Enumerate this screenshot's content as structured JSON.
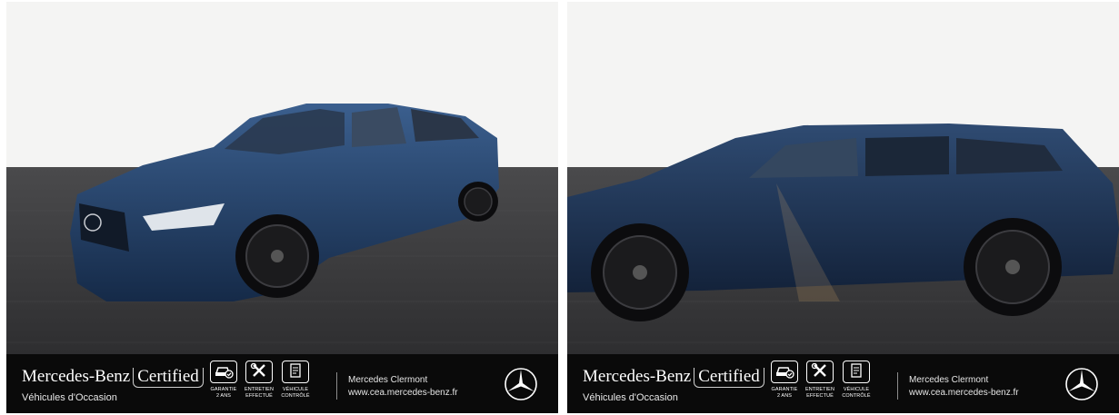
{
  "panels": [
    {
      "id": "front-three-quarter",
      "brand_name": "Mercedes-Benz",
      "brand_certified": "Certified",
      "subtitle": "Véhicules d'Occasion",
      "badges": [
        {
          "icon": "car-check-icon",
          "line1": "GARANTIE",
          "line2": "2 ANS"
        },
        {
          "icon": "tools-icon",
          "line1": "ENTRETIEN",
          "line2": "EFFECTUÉ"
        },
        {
          "icon": "checklist-icon",
          "line1": "VÉHICULE",
          "line2": "CONTRÔLÉ"
        }
      ],
      "dealer_name": "Mercedes Clermont",
      "dealer_url": "www.cea.mercedes-benz.fr",
      "logo": "mercedes-star-icon"
    },
    {
      "id": "side-profile",
      "brand_name": "Mercedes-Benz",
      "brand_certified": "Certified",
      "subtitle": "Véhicules d'Occasion",
      "badges": [
        {
          "icon": "car-check-icon",
          "line1": "GARANTIE",
          "line2": "2 ANS"
        },
        {
          "icon": "tools-icon",
          "line1": "ENTRETIEN",
          "line2": "EFFECTUÉ"
        },
        {
          "icon": "checklist-icon",
          "line1": "VÉHICULE",
          "line2": "CONTRÔLÉ"
        }
      ],
      "dealer_name": "Mercedes Clermont",
      "dealer_url": "www.cea.mercedes-benz.fr",
      "logo": "mercedes-star-icon"
    }
  ],
  "colors": {
    "car_body": "#1f3a62",
    "wall": "#f3f3f2",
    "pavement": "#3a3a3c",
    "footer": "#0a0a0a"
  }
}
